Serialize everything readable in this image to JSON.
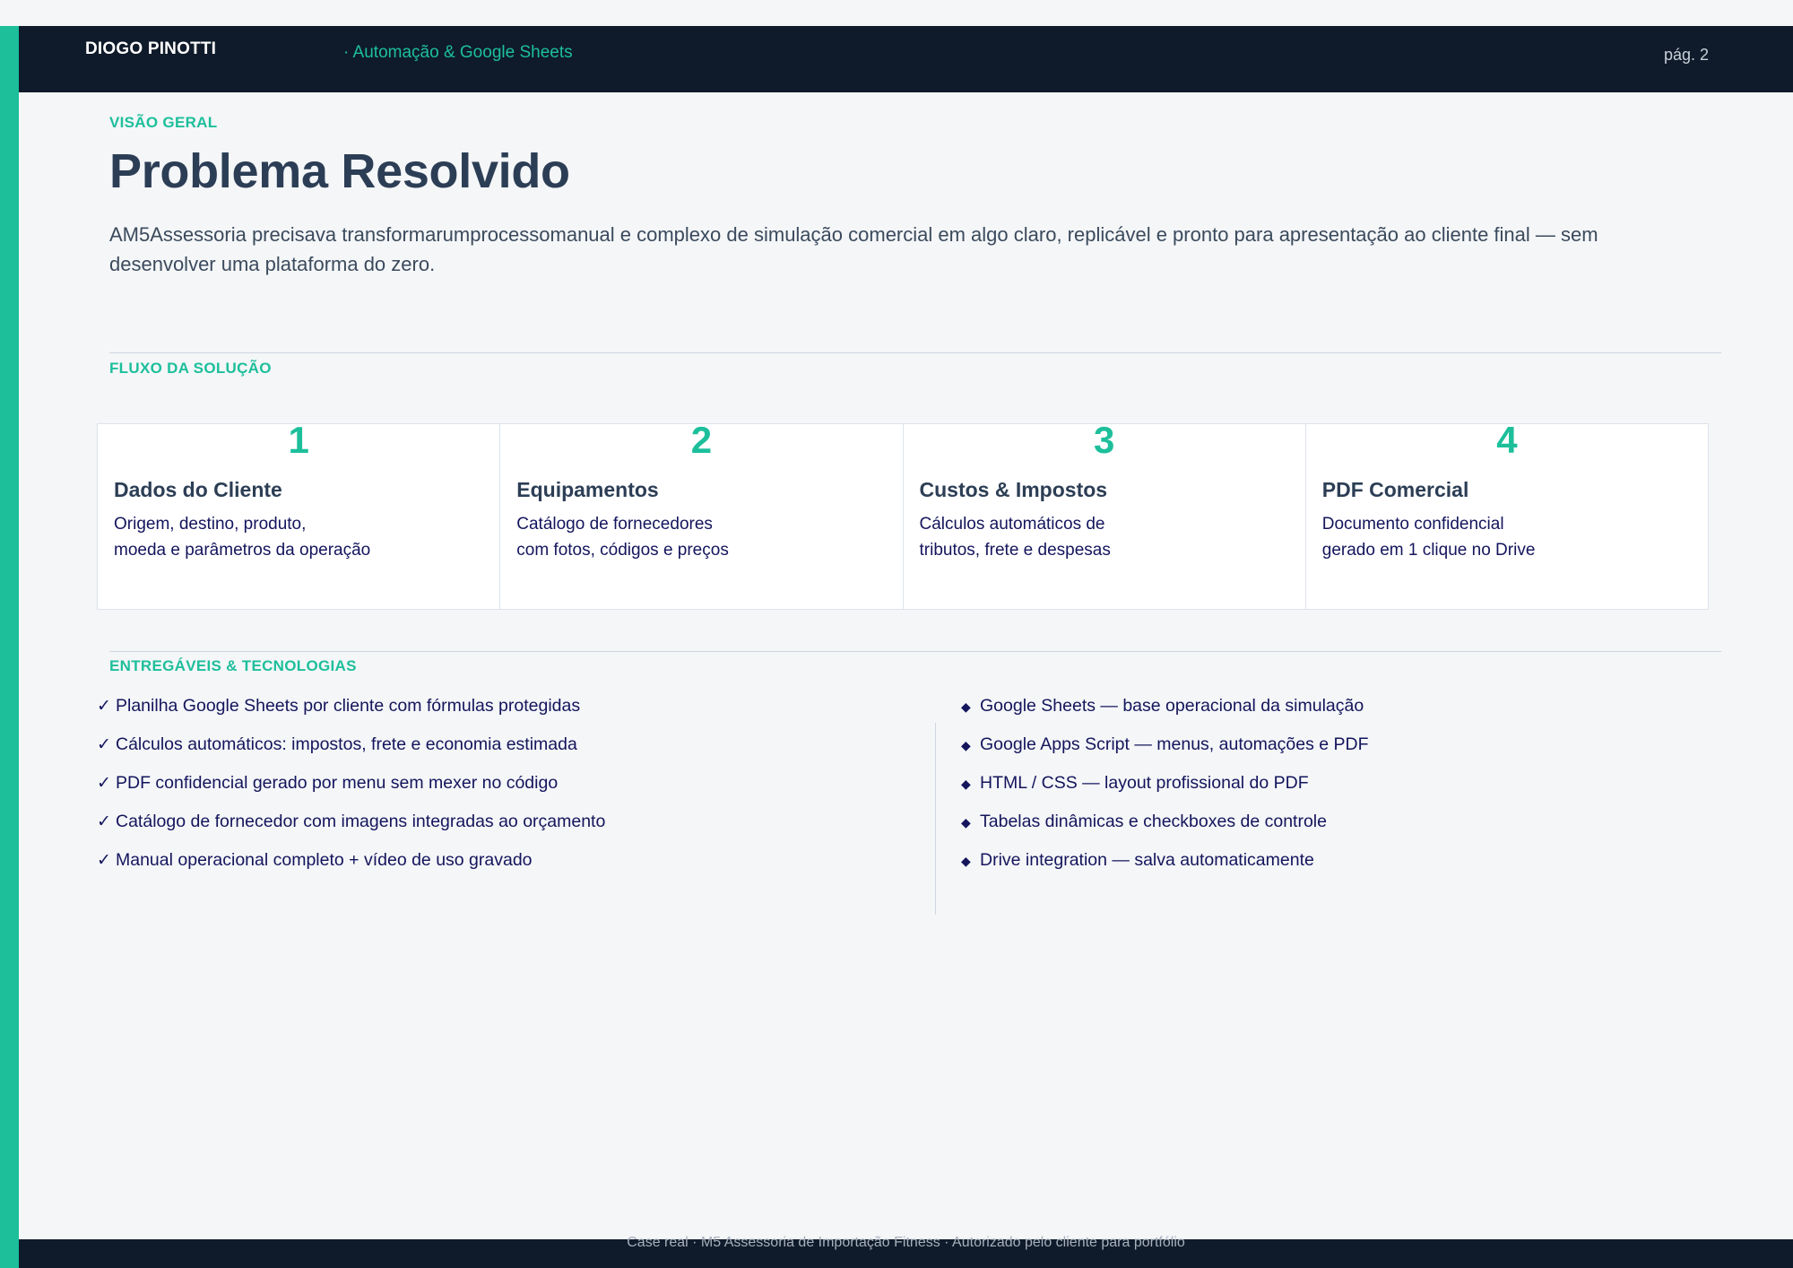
{
  "header": {
    "brand": "DIOGO PINOTTI",
    "subtitle": "· Automação & Google Sheets",
    "page": "pág. 2"
  },
  "overview": {
    "label": "VISÃO GERAL",
    "title": "Problema Resolvido",
    "intro": "AM5Assessoria precisava transformarumprocessomanual e complexo de simulação comercial em algo claro, replicável e pronto para apresentação ao cliente final — sem desenvolver uma plataforma do zero."
  },
  "flow": {
    "label": "FLUXO DA SOLUÇÃO",
    "steps": [
      {
        "num": "1",
        "title": "Dados do Cliente",
        "desc": "Origem, destino, produto,\nmoeda e parâmetros da operação"
      },
      {
        "num": "2",
        "title": "Equipamentos",
        "desc": "Catálogo de fornecedores\ncom fotos, códigos e preços"
      },
      {
        "num": "3",
        "title": "Custos & Impostos",
        "desc": "Cálculos automáticos de\ntributos, frete e despesas"
      },
      {
        "num": "4",
        "title": "PDF Comercial",
        "desc": "Documento confidencial\ngerado em 1 clique no Drive"
      }
    ]
  },
  "deliverables": {
    "label": "ENTREGÁVEIS & TECNOLOGIAS",
    "check_symbol": "✓",
    "bullet_symbol": "◆",
    "items": [
      "Planilha Google Sheets por cliente com fórmulas protegidas",
      "Cálculos automáticos: impostos, frete e economia estimada",
      "PDF confidencial gerado por menu sem mexer no código",
      "Catálogo de fornecedor com imagens integradas ao orçamento",
      "Manual operacional completo + vídeo de uso gravado"
    ],
    "technologies": [
      "Google Sheets — base operacional da simulação",
      "Google Apps Script — menus, automações e PDF",
      "HTML / CSS — layout profissional do PDF",
      "Tabelas dinâmicas e checkboxes de controle",
      "Drive integration — salva automaticamente"
    ]
  },
  "footer": {
    "text": "Case real · M5 Assessoria de Importação Fitness · Autorizado pelo cliente para portfólio"
  },
  "colors": {
    "accent": "#1dbf9b",
    "dark": "#0f1b2a",
    "title": "#2c3e55",
    "text_navy": "#14155c",
    "background": "#f4f6f8"
  }
}
